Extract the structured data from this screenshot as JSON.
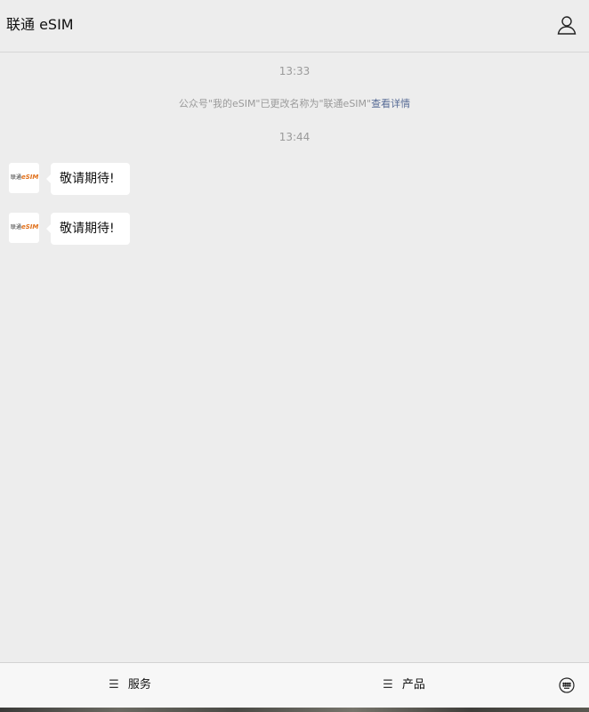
{
  "header": {
    "title": "联通 eSIM",
    "profile_icon": "person-outline-icon"
  },
  "messages": {
    "timestamps": [
      "13:33",
      "13:44"
    ],
    "system_notice": {
      "text": "公众号\"我的eSIM\"已更改名称为\"联通eSIM\"",
      "link": "查看详情"
    },
    "items": [
      {
        "avatar_logo_prefix": "联通",
        "avatar_logo_brand": "eSIM",
        "text": "敬请期待!"
      },
      {
        "avatar_logo_prefix": "联通",
        "avatar_logo_brand": "eSIM",
        "text": "敬请期待!"
      }
    ]
  },
  "bottom_menu": {
    "items": [
      {
        "label": "服务",
        "icon": "☰"
      },
      {
        "label": "产品",
        "icon": "☰"
      }
    ],
    "keyboard_icon": "keyboard-toggle-icon"
  },
  "colors": {
    "background": "#ededed",
    "link": "#576b95",
    "timestamp": "#9a9a9a",
    "bubble": "#ffffff",
    "brand_orange": "#e0701a"
  }
}
